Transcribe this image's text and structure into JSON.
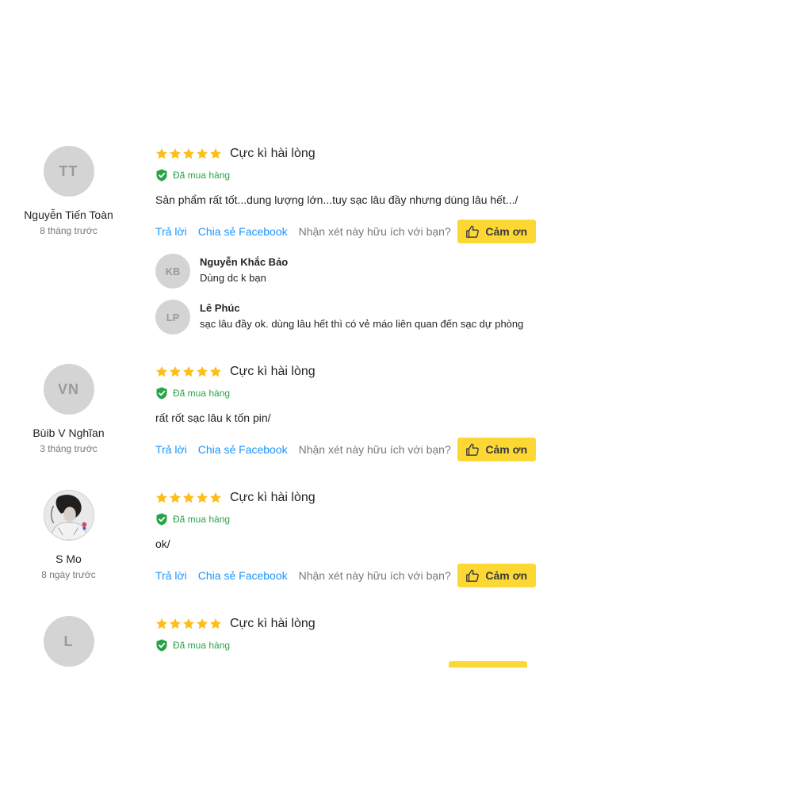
{
  "colors": {
    "star": "#fdbd1b",
    "verified": "#27a348",
    "link": "#1a94ff",
    "button": "#fdd835"
  },
  "reviews": [
    {
      "author": {
        "initials": "TT",
        "name": "Nguyễn Tiến Toàn",
        "time": "8 tháng trước"
      },
      "rating": 5,
      "title": "Cực kì hài lòng",
      "verified": "Đã mua hàng",
      "content": "Sản phẩm rất tốt...dung lượng lớn...tuy sạc lâu đầy nhưng dùng lâu hết.../",
      "actions": {
        "reply": "Trả lời",
        "share": "Chia sẻ Facebook",
        "helpful": "Nhận xét này hữu ích với bạn?",
        "thanks": "Cảm ơn"
      },
      "replies": [
        {
          "initials": "KB",
          "name": "Nguyễn Khắc Bảo",
          "content": "Dùng dc k bạn"
        },
        {
          "initials": "LP",
          "name": "Lê Phúc",
          "content": "sạc lâu đầy ok. dùng lâu hết thì có vẻ máo liên quan đến sạc dự phòng"
        }
      ]
    },
    {
      "author": {
        "initials": "VN",
        "name": "Bùib V Nghĩan",
        "time": "3 tháng trước"
      },
      "rating": 5,
      "title": "Cực kì hài lòng",
      "verified": "Đã mua hàng",
      "content": "rất rốt sạc lâu k tốn pin/",
      "actions": {
        "reply": "Trả lời",
        "share": "Chia sẻ Facebook",
        "helpful": "Nhận xét này hữu ích với bạn?",
        "thanks": "Cảm ơn"
      }
    },
    {
      "author": {
        "initials": "",
        "name": "S Mo",
        "time": "8 ngày trước",
        "avatar": "photo"
      },
      "rating": 5,
      "title": "Cực kì hài lòng",
      "verified": "Đã mua hàng",
      "content": "ok/",
      "actions": {
        "reply": "Trả lời",
        "share": "Chia sẻ Facebook",
        "helpful": "Nhận xét này hữu ích với bạn?",
        "thanks": "Cảm ơn"
      }
    },
    {
      "author": {
        "initials": "L"
      },
      "rating": 5,
      "title": "Cực kì hài lòng",
      "verified": "Đã mua hàng"
    }
  ]
}
